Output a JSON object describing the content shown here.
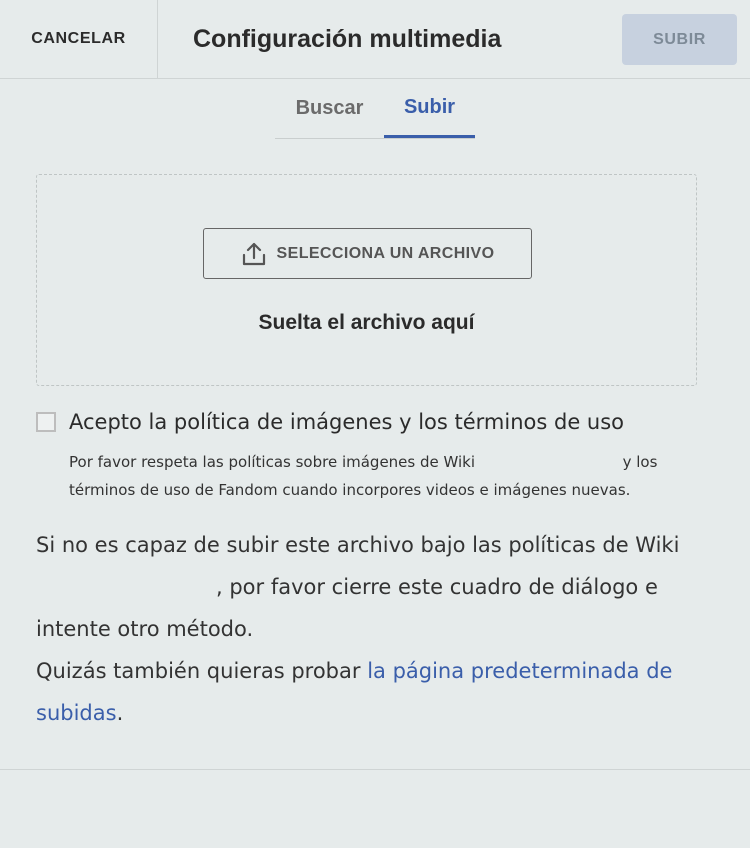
{
  "header": {
    "cancel_label": "CANCELAR",
    "title": "Configuración multimedia",
    "submit_label": "SUBIR"
  },
  "tabs": [
    {
      "label": "Buscar",
      "active": false
    },
    {
      "label": "Subir",
      "active": true
    }
  ],
  "dropzone": {
    "button_label": "SELECCIONA UN ARCHIVO",
    "button_icon": "upload-icon",
    "drop_text": "Suelta el archivo aquí"
  },
  "policy": {
    "checkbox_label": "Acepto la política de imágenes y los términos de uso",
    "text_before": "Por favor respeta las políticas sobre imágenes de Wiki",
    "text_after": "y los términos de uso de Fandom cuando incorpores videos e imágenes nuevas."
  },
  "info": {
    "line1": "Si no es capaz de subir este archivo bajo las políticas de Wiki",
    "line1_after": ", por favor cierre este cuadro de diálogo e intente otro método.",
    "line2_before": "Quizás también quieras probar ",
    "link_text": "la página predeterminada de subidas",
    "line2_after": "."
  },
  "colors": {
    "background": "#e6ebeb",
    "accent": "#3a5eaa",
    "submit_disabled_bg": "#c7d1df"
  }
}
